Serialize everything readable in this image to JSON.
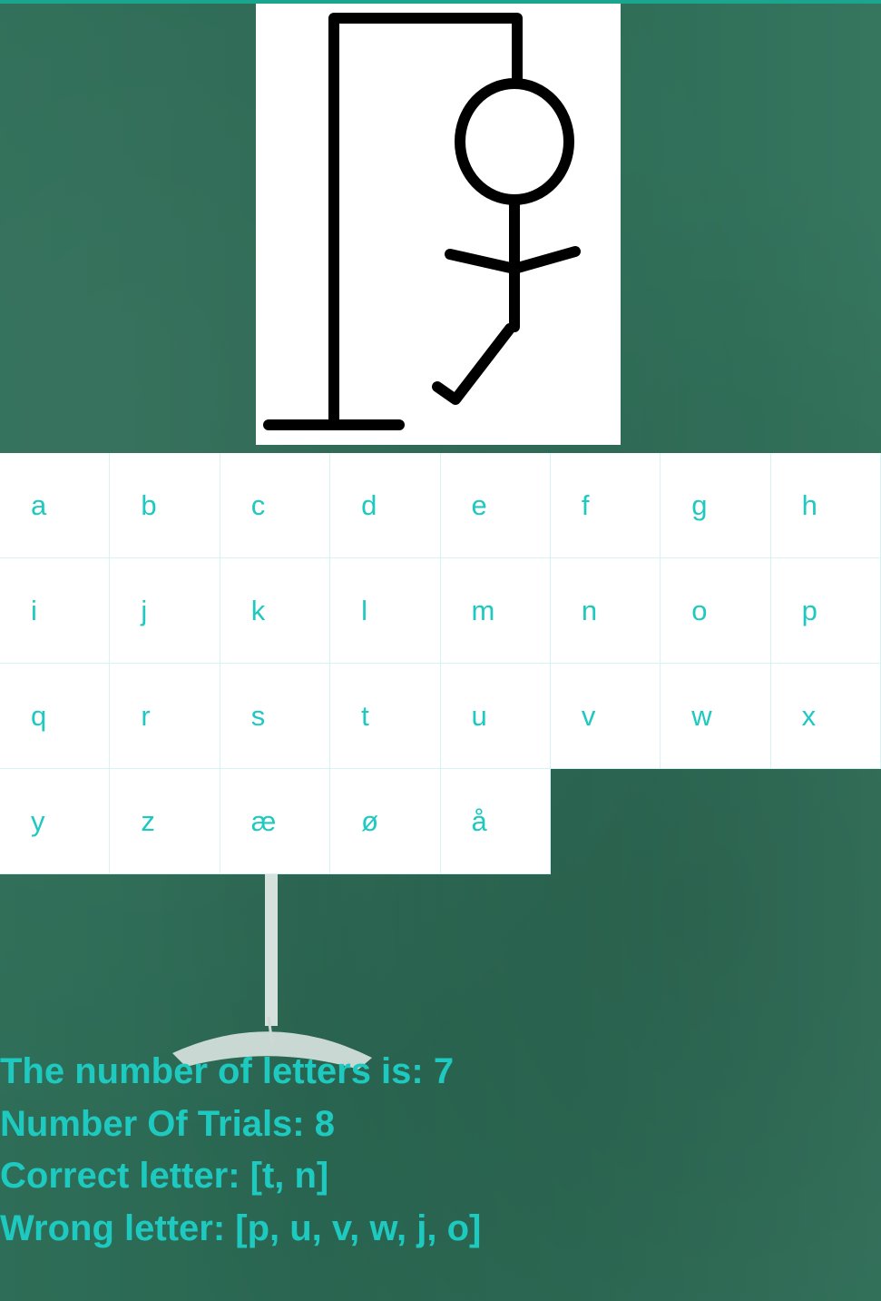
{
  "colors": {
    "accent": "#1ec9c0",
    "top_bar": "#1aa58f",
    "board": "#2c6b55",
    "key_bg": "#ffffff",
    "figure": "#000000"
  },
  "hangman": {
    "image": "hangman-drawing",
    "wrong_guesses_shown": 6
  },
  "keyboard": {
    "letters": [
      "a",
      "b",
      "c",
      "d",
      "e",
      "f",
      "g",
      "h",
      "i",
      "j",
      "k",
      "l",
      "m",
      "n",
      "o",
      "p",
      "q",
      "r",
      "s",
      "t",
      "u",
      "v",
      "w",
      "x",
      "y",
      "z",
      "æ",
      "ø",
      "å"
    ]
  },
  "status": {
    "letter_count": "The number of letters is: 7",
    "trials": "Number Of Trials: 8",
    "correct": "Correct letter: [t, n]",
    "wrong": "Wrong letter: [p, u, v, w, j, o]"
  }
}
